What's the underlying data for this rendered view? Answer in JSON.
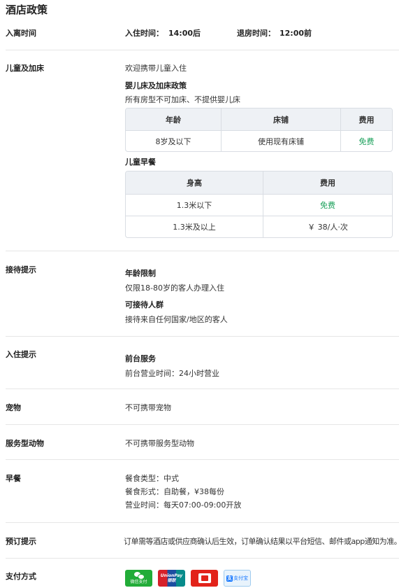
{
  "page": {
    "title": "酒店政策"
  },
  "checkin": {
    "label": "入离时间",
    "checkin_label": "入住时间：",
    "checkin_time": "14:00后",
    "checkout_label": "退房时间：",
    "checkout_time": "12:00前"
  },
  "children": {
    "label": "儿童及加床",
    "welcome": "欢迎携带儿童入住",
    "crib_title": "婴儿床及加床政策",
    "crib_desc": "所有房型不可加床、不提供婴儿床",
    "bed_table": {
      "headers": [
        "年龄",
        "床铺",
        "费用"
      ],
      "rows": [
        [
          "8岁及以下",
          "使用现有床铺",
          "免费"
        ]
      ]
    },
    "breakfast_title": "儿童早餐",
    "breakfast_table": {
      "headers": [
        "身高",
        "费用"
      ],
      "rows": [
        [
          "1.3米以下",
          "免费"
        ],
        [
          "1.3米及以上",
          "￥ 38/人·次"
        ]
      ]
    }
  },
  "reception": {
    "label": "接待提示",
    "age_title": "年龄限制",
    "age_desc": "仅限18-80岁的客人办理入住",
    "guests_title": "可接待人群",
    "guests_desc": "接待来自任何国家/地区的客人"
  },
  "checkin_tips": {
    "label": "入住提示",
    "desk_title": "前台服务",
    "desk_desc": "前台营业时间：24小时营业"
  },
  "pets": {
    "label": "宠物",
    "desc": "不可携带宠物"
  },
  "service_animals": {
    "label": "服务型动物",
    "desc": "不可携带服务型动物"
  },
  "breakfast": {
    "label": "早餐",
    "type": "餐食类型：中式",
    "form": "餐食形式：自助餐，¥38每份",
    "hours": "营业时间：每天07:00-09:00开放"
  },
  "booking": {
    "label": "预订提示",
    "desc": "订单需等酒店或供应商确认后生效，订单确认结果以平台短信、邮件或app通知为准。"
  },
  "payment": {
    "label": "支付方式",
    "methods": [
      {
        "name": "wechat-pay-icon",
        "text": "微信支付"
      },
      {
        "name": "unionpay-icon",
        "text_top": "UnionPay",
        "text_bottom": "银联"
      },
      {
        "name": "jd-pay-icon"
      },
      {
        "name": "alipay-icon",
        "glyph": "支",
        "text": "支付宝"
      }
    ]
  },
  "colors": {
    "free": "#1aa05a",
    "divider": "#e6e6e6",
    "table_header": "#eef1f5"
  }
}
